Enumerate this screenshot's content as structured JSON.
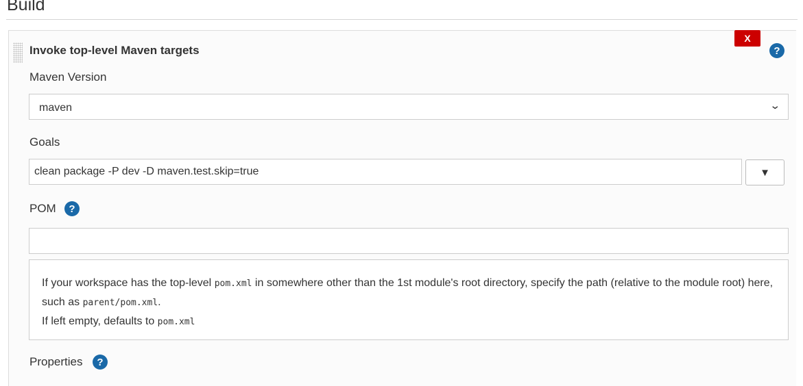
{
  "section": {
    "title": "Build"
  },
  "step": {
    "title": "Invoke top-level Maven targets",
    "delete_label": "X",
    "help_glyph": "?"
  },
  "maven_version": {
    "label": "Maven Version",
    "selected": "maven",
    "chevron_icon": "chevron-down-icon"
  },
  "goals": {
    "label": "Goals",
    "value": "clean package -P dev -D maven.test.skip=true",
    "expand_glyph": "▼"
  },
  "pom": {
    "label": "POM",
    "help_glyph": "?",
    "value": "",
    "help": {
      "part1": "If your workspace has the top-level ",
      "code1": "pom.xml",
      "part2": " in somewhere other than the 1st module's root directory, specify the path (relative to the module root) here, such as ",
      "code2": "parent/pom.xml",
      "part3": ".",
      "part4": "If left empty, defaults to ",
      "code3": "pom.xml"
    }
  },
  "properties": {
    "label": "Properties",
    "help_glyph": "?"
  },
  "colors": {
    "help_icon": "#1a69a8",
    "delete_button": "#cc0000"
  }
}
